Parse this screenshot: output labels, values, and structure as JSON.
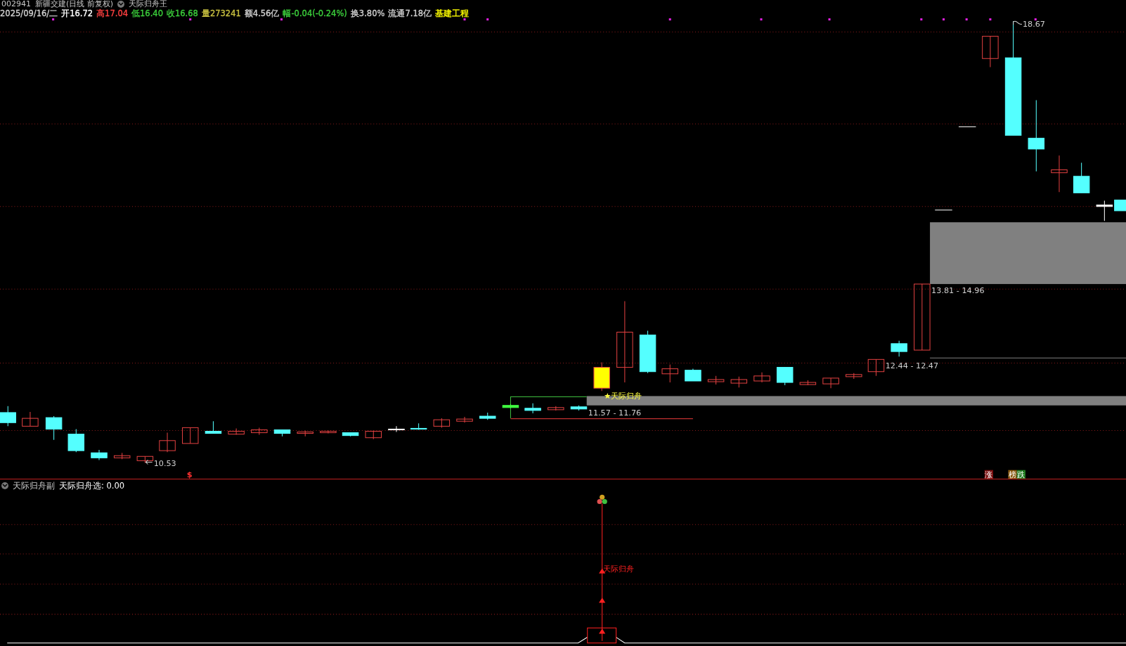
{
  "header": {
    "code": "002941",
    "name": "新疆交建(日线 前复权)",
    "indicator": "天际归舟王"
  },
  "quote": [
    {
      "text": "2025/09/16/二",
      "color": "#d0d0d0"
    },
    {
      "text": "开16.72",
      "color": "#ffffff"
    },
    {
      "text": "高17.04",
      "color": "#ff4040"
    },
    {
      "text": "低16.40",
      "color": "#3cd03c"
    },
    {
      "text": "收16.68",
      "color": "#3cd03c"
    },
    {
      "text": "量273241",
      "color": "#c8c040"
    },
    {
      "text": "额4.56亿",
      "color": "#d0d0d0"
    },
    {
      "text": "幅-0.04(-0.24%)",
      "color": "#3cd03c"
    },
    {
      "text": "换3.80%",
      "color": "#d0d0d0"
    },
    {
      "text": "流通7.18亿",
      "color": "#d0d0d0"
    },
    {
      "text": "基建工程",
      "color": "#ffff00"
    }
  ],
  "chart": {
    "high_label": "18.67",
    "low_label": "10.53",
    "signal_label": "★天际归舟",
    "marker": "$",
    "zones": [
      {
        "text": "13.81 - 14.96"
      },
      {
        "text": "12.44 - 12.47"
      },
      {
        "text": "11.57 - 11.76"
      }
    ],
    "badges": [
      {
        "text": "涨",
        "color": "#7a1010"
      },
      {
        "text": "榜",
        "color": "#8a5a10"
      },
      {
        "text": "跌",
        "color": "#1e7a1e"
      }
    ]
  },
  "sub_panel": {
    "title": "天际归舟副",
    "reading": "天际归舟选: 0.00",
    "signal_label": "天际归舟"
  }
}
